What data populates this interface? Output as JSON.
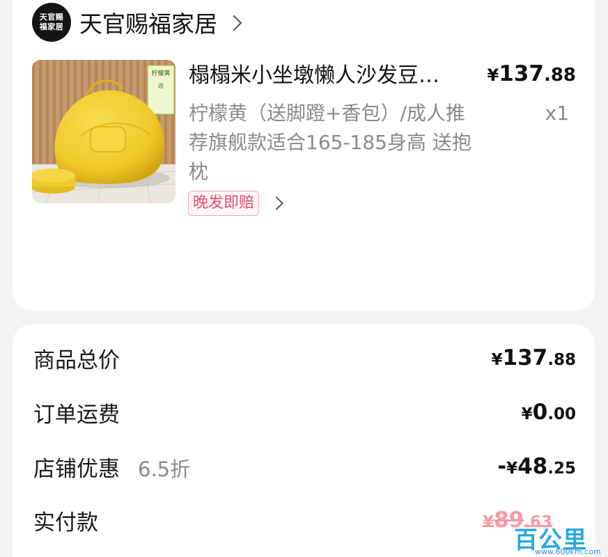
{
  "store": {
    "logo_line1": "天官赐",
    "logo_line2": "福家居",
    "name": "天官赐福家居"
  },
  "item": {
    "title": "榻榻米小坐墩懒人沙发豆…",
    "spec": "柠檬黄（送脚蹬+香包）/成人推荐旗舰款适合165-185身高 送抱枕",
    "price_yen": "¥",
    "price_int": "137",
    "price_dec": ".88",
    "quantity": "x1",
    "tag": "晚发即赔",
    "thumb_sign_line1": "柠檬黄",
    "thumb_sign_line2": "送",
    "colors": {
      "bag": "#f2cf2f",
      "bag_shade": "#d9b016",
      "wall": "#b98e62",
      "floor": "#e9e5df",
      "tag_text": "#e04e6c"
    }
  },
  "summary": {
    "rows": [
      {
        "label": "商品总价",
        "sub": "",
        "sign": "",
        "yen": "¥",
        "int": "137",
        "dec": ".88"
      },
      {
        "label": "订单运费",
        "sub": "",
        "sign": "",
        "yen": "¥",
        "int": "0",
        "dec": ".00"
      },
      {
        "label": "店铺优惠",
        "sub": "6.5折",
        "sign": "-",
        "yen": "¥",
        "int": "48",
        "dec": ".25"
      },
      {
        "label": "实付款",
        "sub": "",
        "sign": "",
        "yen": "¥",
        "int": "89",
        "dec": ".63"
      }
    ]
  },
  "watermark": {
    "logo": "百公里",
    "url": "www.600km.com"
  }
}
